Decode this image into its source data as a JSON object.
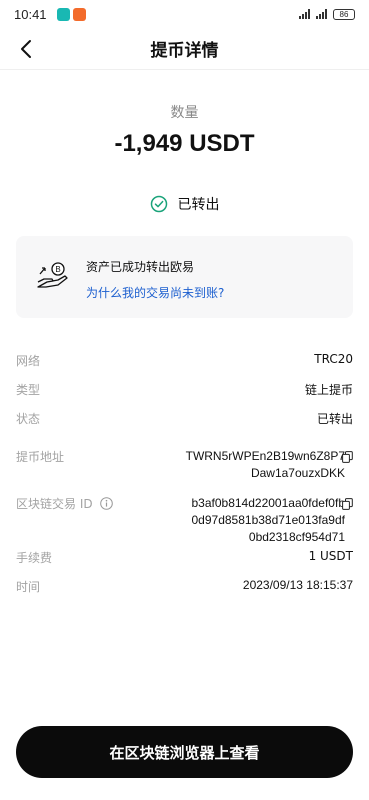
{
  "status_bar": {
    "time": "10:41",
    "battery": "86"
  },
  "header": {
    "title": "提币详情"
  },
  "amount": {
    "label": "数量",
    "value": "-1,949 USDT"
  },
  "status": {
    "text": "已转出"
  },
  "info_card": {
    "title": "资产已成功转出欧易",
    "link": "为什么我的交易尚未到账?"
  },
  "details": {
    "network": {
      "label": "网络",
      "value": "TRC20"
    },
    "type": {
      "label": "类型",
      "value": "链上提币"
    },
    "state": {
      "label": "状态",
      "value": "已转出"
    },
    "address": {
      "label": "提币地址",
      "line1": "TWRN5rWPEn2B19wn6Z8P7",
      "line2": "Daw1a7ouzxDKK"
    },
    "txid": {
      "label": "区块链交易 ID",
      "line1": "b3af0b814d22001aa0fdef0fb",
      "line2": "0d97d8581b38d71e013fa9df",
      "line3": "0bd2318cf954d71"
    },
    "fee": {
      "label": "手续费",
      "value": "1 USDT"
    },
    "time": {
      "label": "时间",
      "value": "2023/09/13 18:15:37"
    }
  },
  "button": {
    "label": "在区块链浏览器上查看"
  },
  "colors": {
    "accent_green": "#1aa37a",
    "link_blue": "#1c5fcf",
    "button_black": "#0b0b0b"
  }
}
